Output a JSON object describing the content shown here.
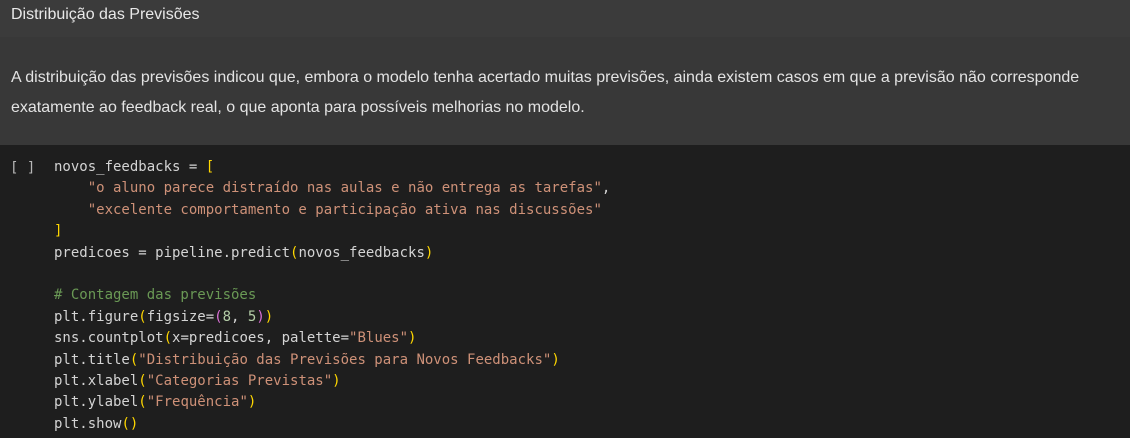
{
  "markdown_cell": {
    "heading": "Distribuição das Previsões",
    "paragraph": "A distribuição das previsões indicou que, embora o modelo tenha acertado muitas previsões, ainda existem casos em que a previsão não corresponde exatamente ao feedback real, o que aponta para possíveis melhorias no modelo."
  },
  "code_cell": {
    "run_indicator": "[ ]",
    "lines": {
      "l1_var": "novos_feedbacks",
      "l1_eq": " = ",
      "l1_bracket": "[",
      "l2_indent": "    ",
      "l2_str": "\"o aluno parece distraído nas aulas e não entrega as tarefas\"",
      "l2_comma": ",",
      "l3_indent": "    ",
      "l3_str": "\"excelente comportamento e participação ativa nas discussões\"",
      "l4_bracket": "]",
      "l5_code": "predicoes = pipeline.predict",
      "l5_open": "(",
      "l5_arg": "novos_feedbacks",
      "l5_close": ")",
      "l7_comment": "# Contagem das previsões",
      "l8_code": "plt.figure",
      "l8_open": "(",
      "l8_arg": "figsize=",
      "l8_open2": "(",
      "l8_n1": "8",
      "l8_sep": ", ",
      "l8_n2": "5",
      "l8_close2": ")",
      "l8_close": ")",
      "l9_code": "sns.countplot",
      "l9_open": "(",
      "l9_arg": "x=predicoes, palette=",
      "l9_str": "\"Blues\"",
      "l9_close": ")",
      "l10_code": "plt.title",
      "l10_open": "(",
      "l10_str": "\"Distribuição das Previsões para Novos Feedbacks\"",
      "l10_close": ")",
      "l11_code": "plt.xlabel",
      "l11_open": "(",
      "l11_str": "\"Categorias Previstas\"",
      "l11_close": ")",
      "l12_code": "plt.ylabel",
      "l12_open": "(",
      "l12_str": "\"Frequência\"",
      "l12_close": ")",
      "l13_code": "plt.show",
      "l13_open": "(",
      "l13_close": ")"
    }
  },
  "colors": {
    "markdown_background": "#383838",
    "code_background": "#1e1e1e",
    "string": "#ce9178",
    "bracket": "#ffd700",
    "bracket_nested": "#da70d6",
    "number": "#b5cea8",
    "comment": "#6a9955"
  }
}
